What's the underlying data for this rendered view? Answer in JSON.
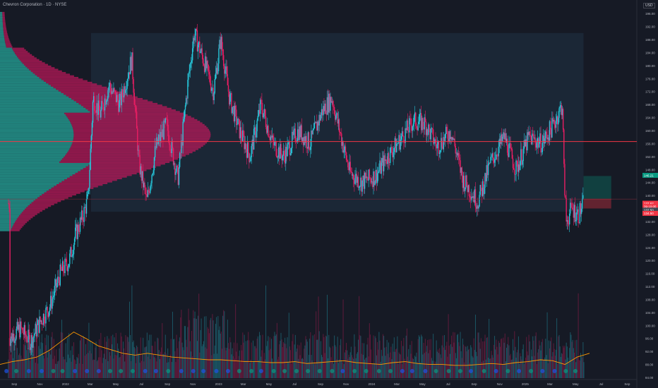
{
  "header": {
    "title": "Chevron Corporation · 1D · NYSE",
    "currency": "USD"
  },
  "chart_data": {
    "type": "candlestick",
    "symbol": "Chevron Corporation · 1D · NYSE",
    "ylim": [
      84,
      198
    ],
    "y_ticks": [
      "196.00",
      "192.00",
      "188.00",
      "184.00",
      "180.00",
      "176.00",
      "172.00",
      "168.00",
      "164.00",
      "160.00",
      "156.00",
      "152.00",
      "148.00",
      "144.00",
      "140.00",
      "136.00",
      "132.00",
      "128.00",
      "124.00",
      "120.00",
      "116.00",
      "112.00",
      "108.00",
      "104.00",
      "100.00",
      "96.00",
      "92.00",
      "88.00",
      "84.00"
    ],
    "x_ticks": [
      "Sep",
      "Nov",
      "2022",
      "Mar",
      "May",
      "Jul",
      "Sep",
      "Nov",
      "2023",
      "Mar",
      "May",
      "Jul",
      "Sep",
      "Nov",
      "2024",
      "Mar",
      "May",
      "Jul",
      "Sep",
      "Nov",
      "2025",
      "Mar",
      "May",
      "Jul",
      "Sep"
    ],
    "price_path": [
      [
        "2021-08-20",
        96
      ],
      [
        "2021-09-15",
        99
      ],
      [
        "2021-10-10",
        95
      ],
      [
        "2021-11-01",
        101
      ],
      [
        "2021-11-25",
        106
      ],
      [
        "2021-12-20",
        116
      ],
      [
        "2022-01-10",
        120
      ],
      [
        "2022-01-25",
        128
      ],
      [
        "2022-02-10",
        133
      ],
      [
        "2022-02-24",
        139
      ],
      [
        "2022-03-08",
        170
      ],
      [
        "2022-03-25",
        165
      ],
      [
        "2022-04-15",
        174
      ],
      [
        "2022-05-10",
        168
      ],
      [
        "2022-06-08",
        182
      ],
      [
        "2022-06-25",
        150
      ],
      [
        "2022-07-14",
        138
      ],
      [
        "2022-08-05",
        155
      ],
      [
        "2022-08-30",
        162
      ],
      [
        "2022-09-26",
        145
      ],
      [
        "2022-10-20",
        175
      ],
      [
        "2022-11-04",
        190
      ],
      [
        "2022-11-28",
        181
      ],
      [
        "2022-12-20",
        172
      ],
      [
        "2023-01-06",
        188
      ],
      [
        "2023-01-27",
        170
      ],
      [
        "2023-02-20",
        160
      ],
      [
        "2023-03-17",
        152
      ],
      [
        "2023-04-12",
        168
      ],
      [
        "2023-05-10",
        156
      ],
      [
        "2023-06-05",
        152
      ],
      [
        "2023-07-10",
        160
      ],
      [
        "2023-08-07",
        156
      ],
      [
        "2023-09-05",
        166
      ],
      [
        "2023-09-28",
        170
      ],
      [
        "2023-10-20",
        158
      ],
      [
        "2023-11-10",
        147
      ],
      [
        "2023-12-08",
        144
      ],
      [
        "2024-01-10",
        146
      ],
      [
        "2024-02-08",
        152
      ],
      [
        "2024-03-08",
        157
      ],
      [
        "2024-04-10",
        163
      ],
      [
        "2024-05-08",
        162
      ],
      [
        "2024-06-05",
        155
      ],
      [
        "2024-07-08",
        160
      ],
      [
        "2024-08-05",
        145
      ],
      [
        "2024-09-10",
        138
      ],
      [
        "2024-10-10",
        150
      ],
      [
        "2024-11-12",
        158
      ],
      [
        "2024-12-10",
        148
      ],
      [
        "2025-01-10",
        158
      ],
      [
        "2025-02-10",
        156
      ],
      [
        "2025-03-10",
        162
      ],
      [
        "2025-03-31",
        168
      ],
      [
        "2025-04-03",
        148
      ],
      [
        "2025-04-09",
        132
      ],
      [
        "2025-04-22",
        136
      ],
      [
        "2025-05-08",
        134
      ],
      [
        "2025-05-20",
        137.6
      ]
    ],
    "range_box": {
      "from": "2022-03-03",
      "to": "2025-05-20",
      "low": 135,
      "high": 190
    },
    "poc_price": 156.6,
    "poc_color": "#f23645",
    "thin_line_price": 138.9,
    "position": {
      "entry": 139,
      "target": 146,
      "stop": 136,
      "from": "2025-05-20",
      "to": "2025-07-25"
    },
    "price_labels": [
      {
        "text": "146.21",
        "price": 146.21,
        "color": "#089981"
      },
      {
        "text": "137.62",
        "price": 137.62,
        "color": "#f23645"
      },
      {
        "text": "39:10:05",
        "price": 136.6,
        "color": "#f23645"
      },
      {
        "text": "137.50",
        "price": 135.5,
        "color": "#434651"
      },
      {
        "text": "134.50",
        "price": 134.5,
        "color": "#f23645"
      }
    ],
    "volume_ma_profile": [
      0.3,
      0.33,
      0.35,
      0.38,
      0.45,
      0.55,
      0.65,
      0.58,
      0.5,
      0.46,
      0.42,
      0.4,
      0.42,
      0.4,
      0.38,
      0.37,
      0.36,
      0.35,
      0.35,
      0.34,
      0.33,
      0.33,
      0.32,
      0.32,
      0.33,
      0.31,
      0.32,
      0.33,
      0.34,
      0.32,
      0.31,
      0.3,
      0.32,
      0.33,
      0.31,
      0.3,
      0.3,
      0.29,
      0.29,
      0.3,
      0.31,
      0.3,
      0.32,
      0.33,
      0.35,
      0.34,
      0.3,
      0.38,
      0.42
    ],
    "colors": {
      "up": "#26c6da",
      "down": "#e91e63",
      "volume_ma": "#ff9800",
      "profile_up": "#26a69a",
      "profile_down": "#c2185b",
      "range_box": "#1c2a3a",
      "text": "#b2b5be"
    }
  }
}
